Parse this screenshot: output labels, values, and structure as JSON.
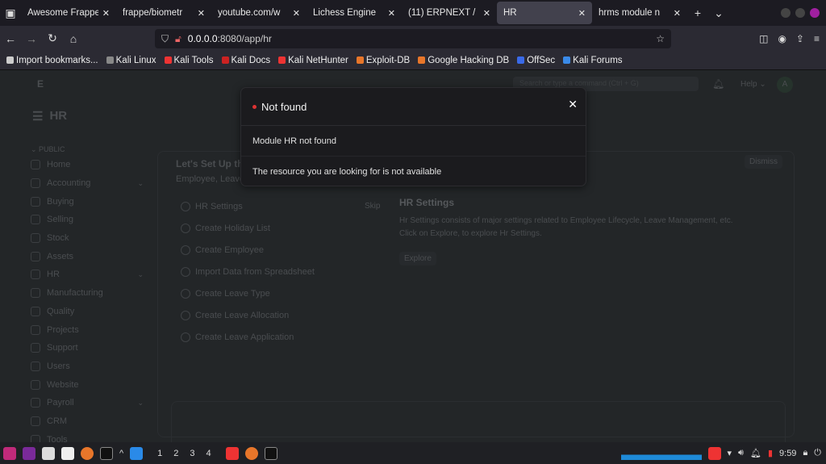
{
  "browser": {
    "tabs": [
      {
        "title": "Awesome Frappe |",
        "active": false
      },
      {
        "title": "frappe/biometr",
        "active": false
      },
      {
        "title": "youtube.com/w",
        "active": false
      },
      {
        "title": "Lichess Engine",
        "active": false
      },
      {
        "title": "(11) ERPNEXT /",
        "active": false
      },
      {
        "title": "HR",
        "active": true
      },
      {
        "title": "hrms module n",
        "active": false
      }
    ],
    "url_host": "0.0.0.0",
    "url_rest": ":8080/app/hr",
    "bookmarks": [
      "Import bookmarks...",
      "Kali Linux",
      "Kali Tools",
      "Kali Docs",
      "Kali NetHunter",
      "Exploit-DB",
      "Google Hacking DB",
      "OffSec",
      "Kali Forums"
    ]
  },
  "app": {
    "logo": "E",
    "search_placeholder": "Search or type a command (Ctrl + G)",
    "help": "Help",
    "avatar": "A",
    "page_title": "HR",
    "section": "PUBLIC",
    "sidebar": [
      {
        "label": "Home"
      },
      {
        "label": "Accounting",
        "expand": true
      },
      {
        "label": "Buying"
      },
      {
        "label": "Selling"
      },
      {
        "label": "Stock"
      },
      {
        "label": "Assets"
      },
      {
        "label": "HR",
        "expand": true
      },
      {
        "label": "Manufacturing"
      },
      {
        "label": "Quality"
      },
      {
        "label": "Projects"
      },
      {
        "label": "Support"
      },
      {
        "label": "Users"
      },
      {
        "label": "Website"
      },
      {
        "label": "Payroll",
        "expand": true
      },
      {
        "label": "CRM"
      },
      {
        "label": "Tools"
      }
    ],
    "onboarding": {
      "title": "Let's Set Up the",
      "subtitle": "Employee, Leave",
      "dismiss": "Dismiss",
      "skip": "Skip",
      "steps": [
        "HR Settings",
        "Create Holiday List",
        "Create Employee",
        "Import Data from Spreadsheet",
        "Create Leave Type",
        "Create Leave Allocation",
        "Create Leave Application"
      ],
      "detail_title": "HR Settings",
      "detail_text_1": "Hr Settings consists of major settings related to Employee Lifecycle, Leave Management, etc.",
      "detail_text_2": "Click on Explore, to explore Hr Settings.",
      "explore": "Explore"
    }
  },
  "modal": {
    "title": "Not found",
    "message": "Module HR not found",
    "detail": "The resource you are looking for is not available",
    "indicator_color": "#d33"
  },
  "taskbar": {
    "workspaces": [
      "1",
      "2",
      "3",
      "4"
    ],
    "clock": "9:59"
  }
}
